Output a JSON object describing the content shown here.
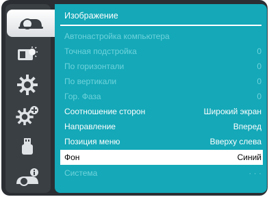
{
  "menu": {
    "title": "Изображение",
    "items": [
      {
        "label": "Автонастройка компьютера",
        "value": ""
      },
      {
        "label": "Точная подстройка",
        "value": "0"
      },
      {
        "label": "По горизонтали",
        "value": "0"
      },
      {
        "label": "По вертикали",
        "value": "0"
      },
      {
        "label": "Гор. Фаза",
        "value": "0"
      },
      {
        "label": "Соотношение сторон",
        "value": "Широкий экран"
      },
      {
        "label": "Направление",
        "value": "Вперед"
      },
      {
        "label": "Позиция меню",
        "value": "Вверху слева"
      },
      {
        "label": "Фон",
        "value": "Синий"
      },
      {
        "label": "Система",
        "value": "· · ·"
      }
    ]
  },
  "sidebar": {
    "tabs": [
      {
        "icon": "projector-icon"
      },
      {
        "icon": "picture-adjust-icon"
      },
      {
        "icon": "settings-gear-icon"
      },
      {
        "icon": "advanced-gears-icon"
      },
      {
        "icon": "usb-icon"
      },
      {
        "icon": "info-projector-icon"
      }
    ]
  },
  "colors": {
    "panel": "#14a8b8",
    "disabled_text": "#6fd3dc",
    "selected_bg": "#ffffff"
  }
}
